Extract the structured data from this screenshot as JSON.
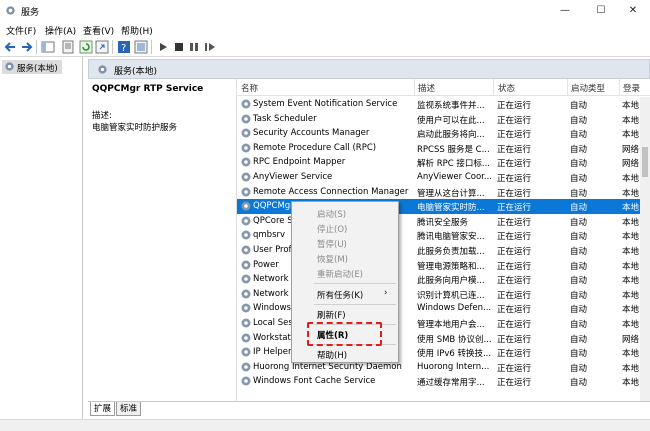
{
  "window": {
    "title": "服务",
    "minimize": "—",
    "maximize": "☐",
    "close": "✕"
  },
  "menubar": [
    "文件(F)",
    "操作(A)",
    "查看(V)",
    "帮助(H)"
  ],
  "left_tree": {
    "root": "服务(本地)"
  },
  "panel_header": "服务(本地)",
  "selected_service": {
    "name": "QQPCMgr RTP Service",
    "desc_label": "描述:",
    "desc": "电脑管家实时防护服务"
  },
  "columns": [
    "名称",
    "描述",
    "状态",
    "启动类型",
    "登录"
  ],
  "rows": [
    {
      "name": "System Event Notification Service",
      "desc": "监视系统事件并...",
      "status": "正在运行",
      "start": "自动",
      "logon": "本地"
    },
    {
      "name": "Task Scheduler",
      "desc": "使用户可以在此...",
      "status": "正在运行",
      "start": "自动",
      "logon": "本地"
    },
    {
      "name": "Security Accounts Manager",
      "desc": "启动此服务将向...",
      "status": "正在运行",
      "start": "自动",
      "logon": "本地"
    },
    {
      "name": "Remote Procedure Call (RPC)",
      "desc": "RPCSS 服务是 C...",
      "status": "正在运行",
      "start": "自动",
      "logon": "网络"
    },
    {
      "name": "RPC Endpoint Mapper",
      "desc": "解析 RPC 接口标...",
      "status": "正在运行",
      "start": "自动",
      "logon": "网络"
    },
    {
      "name": "AnyViewer Service",
      "desc": "AnyViewer Coor...",
      "status": "正在运行",
      "start": "自动",
      "logon": "本地"
    },
    {
      "name": "Remote Access Connection Manager",
      "desc": "管理从这台计算...",
      "status": "正在运行",
      "start": "自动",
      "logon": "本地"
    },
    {
      "name": "QQPCMgr RTP Service",
      "desc": "电脑管家实时防...",
      "status": "正在运行",
      "start": "自动",
      "logon": "本地"
    },
    {
      "name": "QPCore Service",
      "desc": "腾讯安全服务",
      "status": "正在运行",
      "start": "自动",
      "logon": "本地"
    },
    {
      "name": "qmbsrv",
      "desc": "腾讯电脑管家安...",
      "status": "正在运行",
      "start": "自动",
      "logon": "本地"
    },
    {
      "name": "User Profile Service",
      "desc": "此服务负责加载...",
      "status": "正在运行",
      "start": "自动",
      "logon": "本地"
    },
    {
      "name": "Power",
      "desc": "管理电源策略和...",
      "status": "正在运行",
      "start": "自动",
      "logon": "本地"
    },
    {
      "name": "Network Store Interface Service",
      "desc": "此服务向用户模...",
      "status": "正在运行",
      "start": "自动",
      "logon": "本地"
    },
    {
      "name": "Network List Service",
      "desc": "识别计算机已连...",
      "status": "正在运行",
      "start": "自动",
      "logon": "本地"
    },
    {
      "name": "Windows Defender Firewall",
      "desc": "Windows Defen...",
      "status": "正在运行",
      "start": "自动",
      "logon": "本地"
    },
    {
      "name": "Local Session Manager",
      "desc": "管理本地用户会...",
      "status": "正在运行",
      "start": "自动",
      "logon": "本地"
    },
    {
      "name": "Workstation",
      "desc": "使用 SMB 协议创...",
      "status": "正在运行",
      "start": "自动",
      "logon": "网络"
    },
    {
      "name": "IP Helper",
      "desc": "使用 IPv6 转换技...",
      "status": "正在运行",
      "start": "自动",
      "logon": "本地"
    },
    {
      "name": "Huorong Internet Security Daemon",
      "desc": "Huorong Intern...",
      "status": "正在运行",
      "start": "自动",
      "logon": "本地"
    },
    {
      "name": "Windows Font Cache Service",
      "desc": "通过缓存常用字...",
      "status": "正在运行",
      "start": "自动",
      "logon": "本地"
    }
  ],
  "context_menu": {
    "items": [
      "启动(S)",
      "停止(O)",
      "暂停(U)",
      "恢复(M)",
      "重新启动(E)",
      "所有任务(K)",
      "刷新(F)",
      "属性(R)",
      "帮助(H)"
    ],
    "submenu_arrow": "›"
  },
  "tabs": [
    "扩展",
    "标准"
  ],
  "colors": {
    "selection": "#0b78d7",
    "highlight": "#e51c1c"
  }
}
